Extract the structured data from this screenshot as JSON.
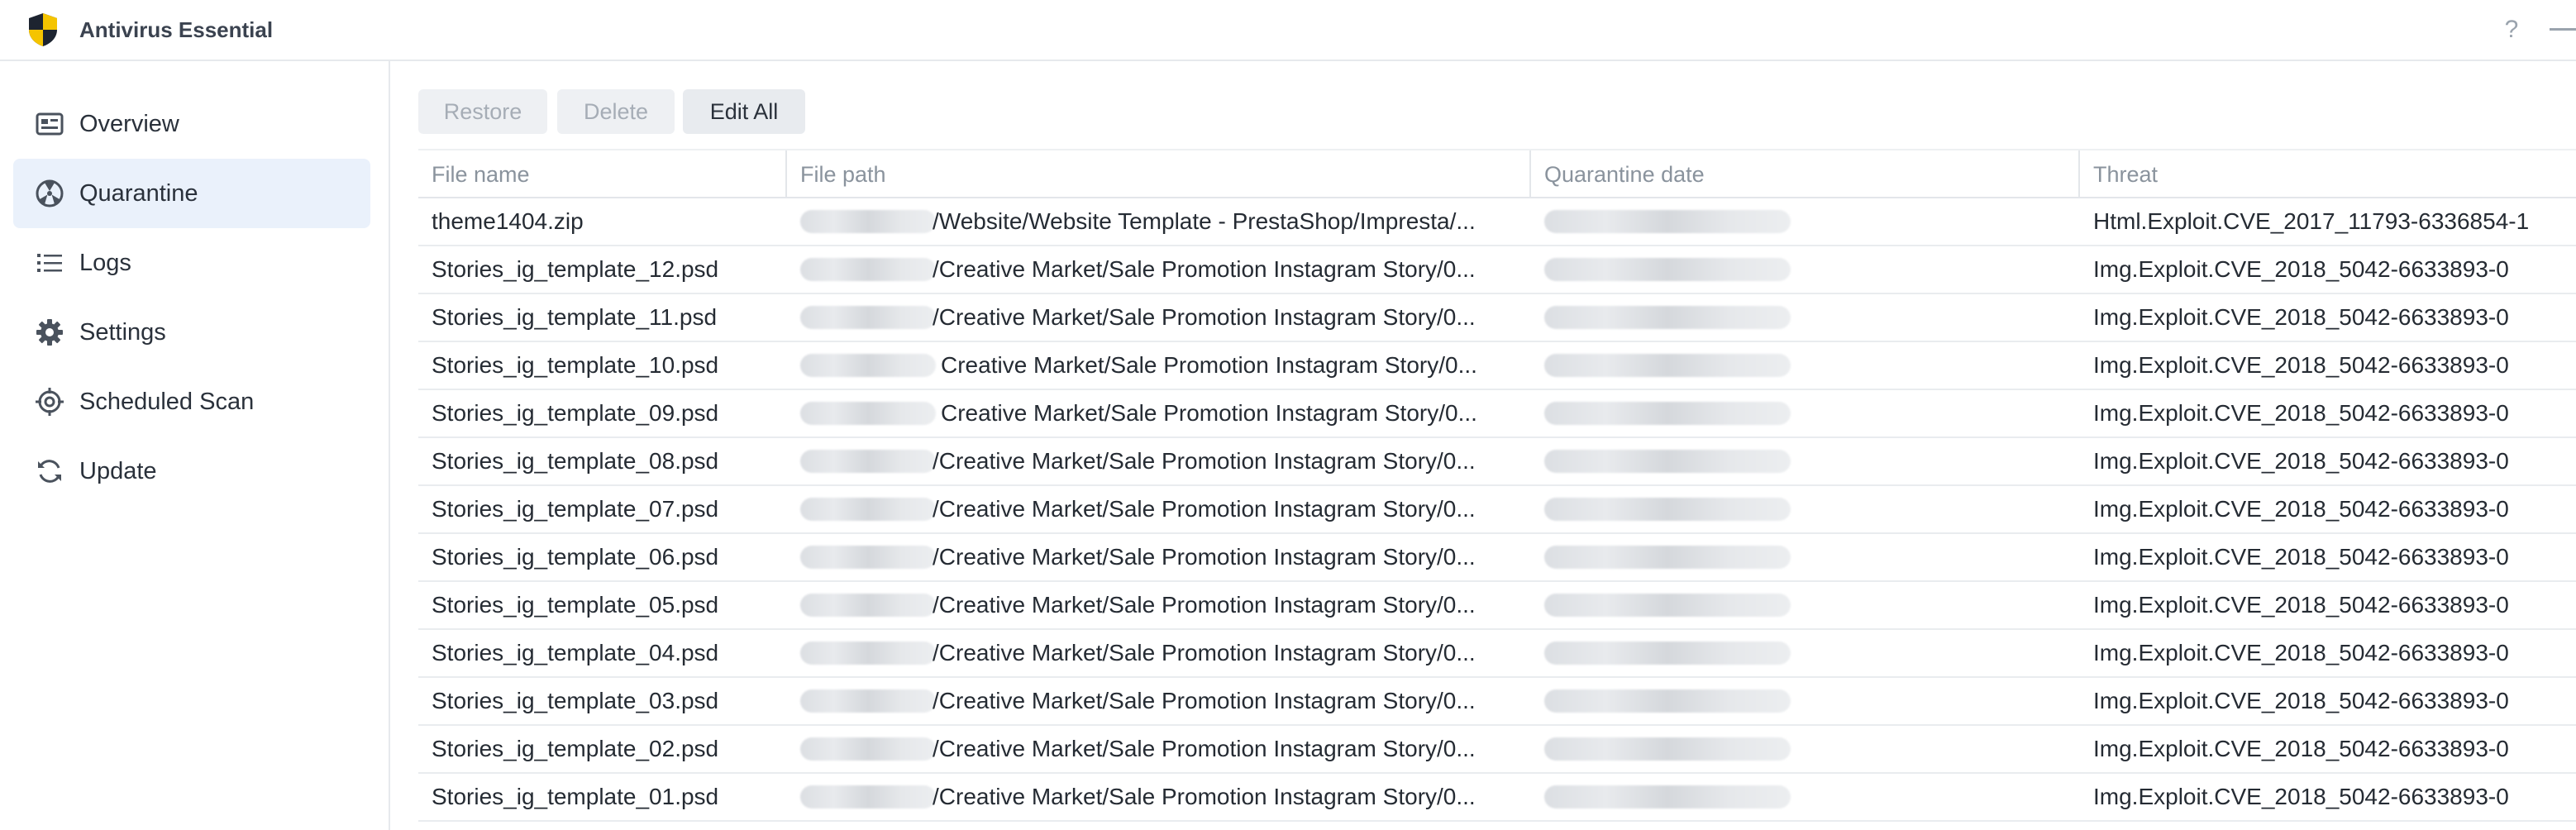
{
  "app": {
    "title": "Antivirus Essential",
    "help_label": "?"
  },
  "sidebar": {
    "items": [
      {
        "label": "Overview",
        "icon": "overview-card-icon",
        "active": false
      },
      {
        "label": "Quarantine",
        "icon": "radiation-icon",
        "active": true
      },
      {
        "label": "Logs",
        "icon": "list-icon",
        "active": false
      },
      {
        "label": "Settings",
        "icon": "gear-icon",
        "active": false
      },
      {
        "label": "Scheduled Scan",
        "icon": "target-icon",
        "active": false
      },
      {
        "label": "Update",
        "icon": "refresh-icon",
        "active": false
      }
    ]
  },
  "toolbar": {
    "restore_label": "Restore",
    "delete_label": "Delete",
    "edit_all_label": "Edit All"
  },
  "table": {
    "columns": [
      "File name",
      "File path",
      "Quarantine date",
      "Threat"
    ],
    "rows": [
      {
        "file_name": "theme1404.zip",
        "file_path": "/Website/Website Template - PrestaShop/Impresta/...",
        "threat": "Html.Exploit.CVE_2017_11793-6336854-1"
      },
      {
        "file_name": "Stories_ig_template_12.psd",
        "file_path": "/Creative Market/Sale Promotion Instagram Story/0...",
        "threat": "Img.Exploit.CVE_2018_5042-6633893-0"
      },
      {
        "file_name": "Stories_ig_template_11.psd",
        "file_path": "/Creative Market/Sale Promotion Instagram Story/0...",
        "threat": "Img.Exploit.CVE_2018_5042-6633893-0"
      },
      {
        "file_name": "Stories_ig_template_10.psd",
        "file_path": "Creative Market/Sale Promotion Instagram Story/0...",
        "threat": "Img.Exploit.CVE_2018_5042-6633893-0"
      },
      {
        "file_name": "Stories_ig_template_09.psd",
        "file_path": "Creative Market/Sale Promotion Instagram Story/0...",
        "threat": "Img.Exploit.CVE_2018_5042-6633893-0"
      },
      {
        "file_name": "Stories_ig_template_08.psd",
        "file_path": "/Creative Market/Sale Promotion Instagram Story/0...",
        "threat": "Img.Exploit.CVE_2018_5042-6633893-0"
      },
      {
        "file_name": "Stories_ig_template_07.psd",
        "file_path": "/Creative Market/Sale Promotion Instagram Story/0...",
        "threat": "Img.Exploit.CVE_2018_5042-6633893-0"
      },
      {
        "file_name": "Stories_ig_template_06.psd",
        "file_path": "/Creative Market/Sale Promotion Instagram Story/0...",
        "threat": "Img.Exploit.CVE_2018_5042-6633893-0"
      },
      {
        "file_name": "Stories_ig_template_05.psd",
        "file_path": "/Creative Market/Sale Promotion Instagram Story/0...",
        "threat": "Img.Exploit.CVE_2018_5042-6633893-0"
      },
      {
        "file_name": "Stories_ig_template_04.psd",
        "file_path": "/Creative Market/Sale Promotion Instagram Story/0...",
        "threat": "Img.Exploit.CVE_2018_5042-6633893-0"
      },
      {
        "file_name": "Stories_ig_template_03.psd",
        "file_path": "/Creative Market/Sale Promotion Instagram Story/0...",
        "threat": "Img.Exploit.CVE_2018_5042-6633893-0"
      },
      {
        "file_name": "Stories_ig_template_02.psd",
        "file_path": "/Creative Market/Sale Promotion Instagram Story/0...",
        "threat": "Img.Exploit.CVE_2018_5042-6633893-0"
      },
      {
        "file_name": "Stories_ig_template_01.psd",
        "file_path": "/Creative Market/Sale Promotion Instagram Story/0...",
        "threat": "Img.Exploit.CVE_2018_5042-6633893-0"
      }
    ]
  },
  "colors": {
    "accent": "#eaf1fb",
    "shield_yellow": "#f5c400",
    "shield_dark": "#1d2430"
  }
}
